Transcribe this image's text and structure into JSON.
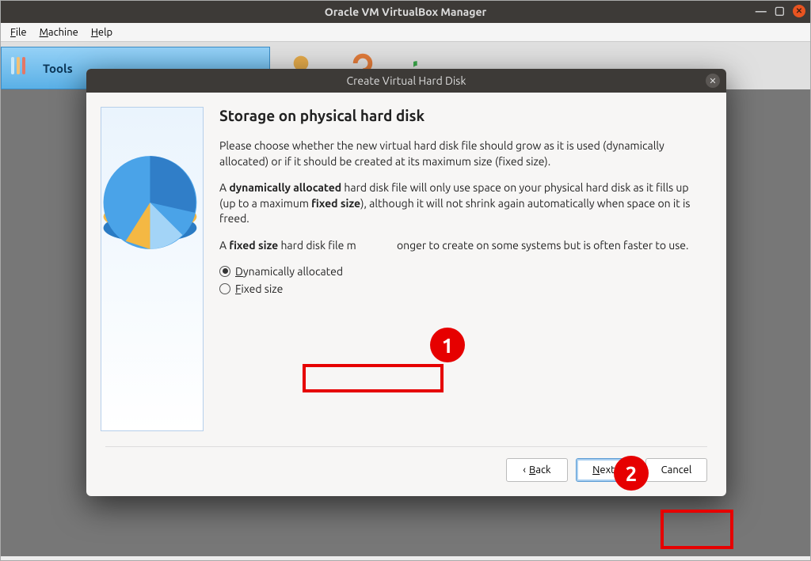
{
  "window": {
    "title": "Oracle VM VirtualBox Manager"
  },
  "menubar": {
    "file": "File",
    "machine": "Machine",
    "help": "Help"
  },
  "sidebar": {
    "tools_label": "Tools"
  },
  "dialog": {
    "title": "Create Virtual Hard Disk",
    "heading": "Storage on physical hard disk",
    "para1": "Please choose whether the new virtual hard disk file should grow as it is used (dynamically allocated) or if it should be created at its maximum size (fixed size).",
    "para2_pre": "A ",
    "para2_bold": "dynamically allocated",
    "para2_mid": " hard disk file will only use space on your physical hard disk as it fills up (up to a maximum ",
    "para2_bold2": "fixed size",
    "para2_post": "), although it will not shrink again automatically when space on it is freed.",
    "para3_pre": "A ",
    "para3_bold": "fixed size",
    "para3_mid": " hard disk file m",
    "para3_post": "onger to create on some systems but is often faster to use.",
    "radio1": "Dynamically allocated",
    "radio2": "Fixed size",
    "back_label": "Back",
    "next_label": "Next",
    "cancel_label": "Cancel"
  },
  "annotations": {
    "a1": "1",
    "a2": "2"
  }
}
